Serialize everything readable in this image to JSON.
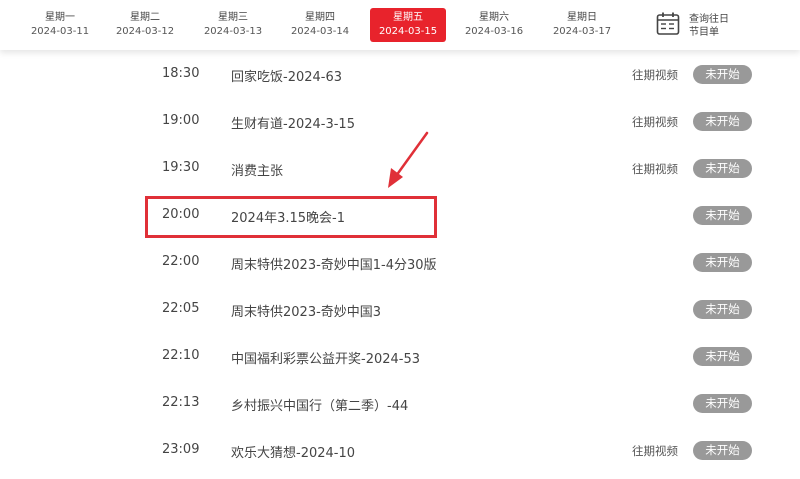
{
  "week_tabs": [
    {
      "day": "星期一",
      "date": "2024-03-11"
    },
    {
      "day": "星期二",
      "date": "2024-03-12"
    },
    {
      "day": "星期三",
      "date": "2024-03-13"
    },
    {
      "day": "星期四",
      "date": "2024-03-14"
    },
    {
      "day": "星期五",
      "date": "2024-03-15"
    },
    {
      "day": "星期六",
      "date": "2024-03-16"
    },
    {
      "day": "星期日",
      "date": "2024-03-17"
    }
  ],
  "active_tab_index": 4,
  "calendar_link": {
    "line1": "查询往日",
    "line2": "节目单",
    "icon": "calendar-icon"
  },
  "programs": [
    {
      "time": "18:30",
      "title": "回家吃饭-2024-63",
      "replay": "往期视频",
      "status": "未开始"
    },
    {
      "time": "19:00",
      "title": "生财有道-2024-3-15",
      "replay": "往期视频",
      "status": "未开始"
    },
    {
      "time": "19:30",
      "title": "消费主张",
      "replay": "往期视频",
      "status": "未开始"
    },
    {
      "time": "20:00",
      "title": "2024年3.15晚会-1",
      "replay": "",
      "status": "未开始"
    },
    {
      "time": "22:00",
      "title": "周末特供2023-奇妙中国1-4分30版",
      "replay": "",
      "status": "未开始"
    },
    {
      "time": "22:05",
      "title": "周末特供2023-奇妙中国3",
      "replay": "",
      "status": "未开始"
    },
    {
      "time": "22:10",
      "title": "中国福利彩票公益开奖-2024-53",
      "replay": "",
      "status": "未开始"
    },
    {
      "time": "22:13",
      "title": "乡村振兴中国行（第二季）-44",
      "replay": "",
      "status": "未开始"
    },
    {
      "time": "23:09",
      "title": "欢乐大猜想-2024-10",
      "replay": "往期视频",
      "status": "未开始"
    }
  ],
  "colors": {
    "active_tab": "#e8232c",
    "highlight_box": "#e03038",
    "status_pill": "#999999"
  }
}
